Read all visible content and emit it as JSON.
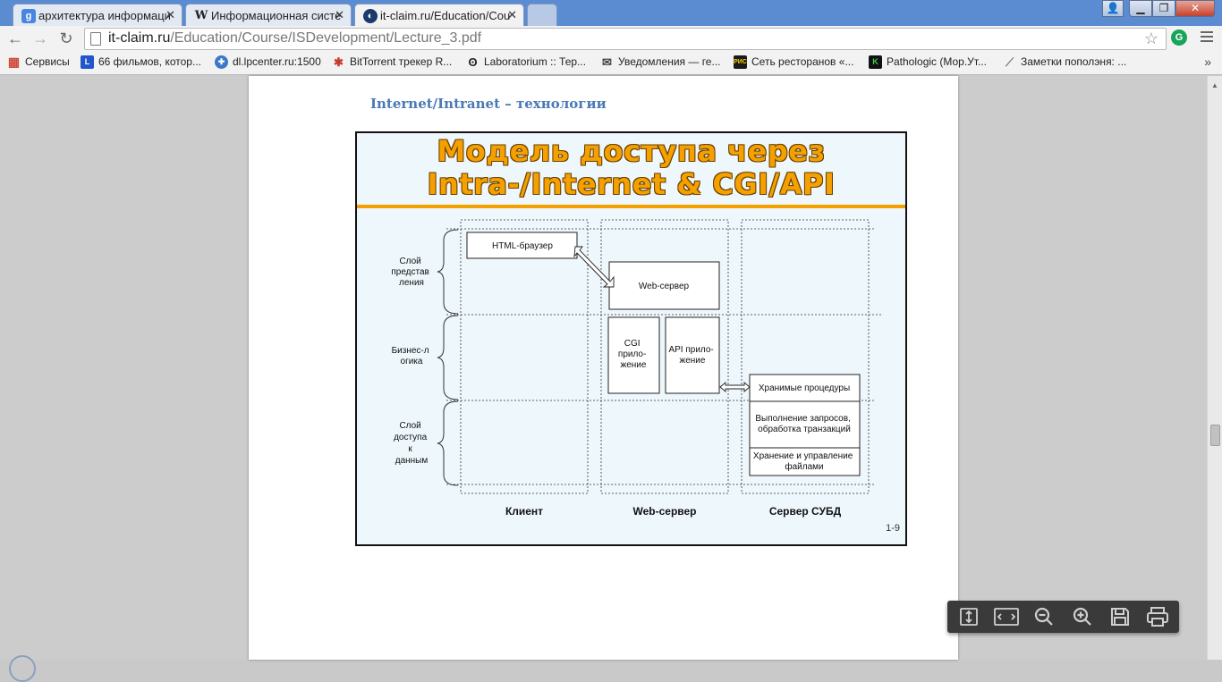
{
  "tabs": [
    {
      "title": "архитектура информаци",
      "icon": "google-icon"
    },
    {
      "title": "Информационная систе",
      "icon": "wikipedia-icon"
    },
    {
      "title": "it-claim.ru/Education/Cou",
      "icon": "globe-icon"
    }
  ],
  "address_bar": {
    "host": "it-claim.ru",
    "path": "/Education/Course/ISDevelopment/Lecture_3.pdf"
  },
  "bookmarks": [
    {
      "label": "Сервисы",
      "icon": "apps-grid-icon",
      "color": "#d04a3a"
    },
    {
      "label": "66 фильмов, котор...",
      "icon": "l-letter-icon",
      "color": "#2255cc"
    },
    {
      "label": "dl.lpcenter.ru:1500",
      "icon": "gear-globe-icon",
      "color": "#3b78c8"
    },
    {
      "label": "BitTorrent трекер R...",
      "icon": "bittorrent-icon",
      "color": "#c63b2b"
    },
    {
      "label": "Laboratorium :: Тер...",
      "icon": "laboratorium-icon",
      "color": "#222222"
    },
    {
      "label": "Уведомления — ге...",
      "icon": "mail-icon",
      "color": "#444444"
    },
    {
      "label": "Сеть ресторанов «...",
      "icon": "restaurant-logo-icon",
      "color": "#1a1a1a"
    },
    {
      "label": "Pathologic (Мор.Ут...",
      "icon": "k-letter-icon",
      "color": "#1f6b2a"
    },
    {
      "label": "Заметки пополэня: ...",
      "icon": "feather-icon",
      "color": "#777777"
    }
  ],
  "document": {
    "heading": "Internet/Intranet – технологии",
    "slide": {
      "title_line1": "Модель доступа через",
      "title_line2": "Intra-/Internet & CGI/API",
      "layers": [
        [
          "Слой",
          "представ",
          "ления"
        ],
        [
          "Бизнес-л",
          "огика"
        ],
        [
          "Слой",
          "доступа",
          "к",
          "данным"
        ]
      ],
      "columns": [
        "Клиент",
        "Web-сервер",
        "Сервер СУБД"
      ],
      "boxes": {
        "browser": [
          "HTML-браузер"
        ],
        "web_server": [
          "Web-сервер"
        ],
        "cgi_app": [
          "CGI",
          "прило-",
          "жение"
        ],
        "api_app": [
          "API прило-",
          "жение"
        ],
        "stored_procs": [
          "Хранимые процедуры"
        ],
        "query_exec": [
          "Выполнение запросов,",
          "обработка транзакций"
        ],
        "file_storage": [
          "Хранение и управление",
          "файлами"
        ]
      },
      "slide_number": "1-9"
    }
  },
  "pdf_controls": [
    "fit-page-icon",
    "fit-width-icon",
    "zoom-out-icon",
    "zoom-in-icon",
    "save-icon",
    "print-icon"
  ]
}
